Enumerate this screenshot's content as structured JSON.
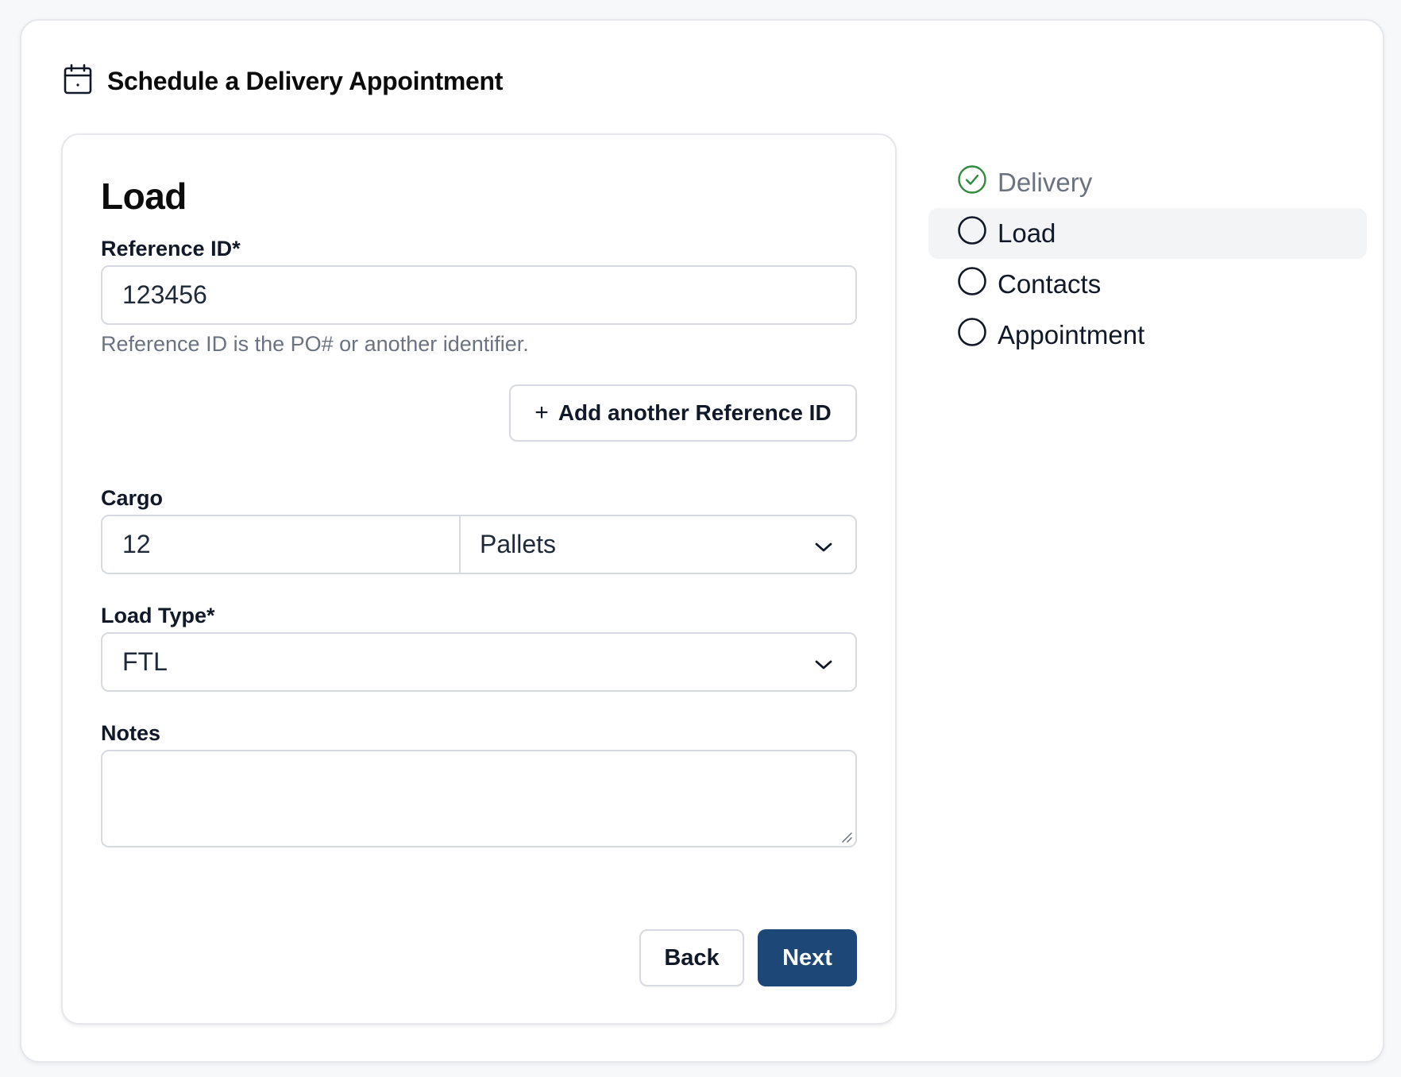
{
  "header": {
    "title": "Schedule a Delivery Appointment",
    "icon": "calendar-icon"
  },
  "form": {
    "section_title": "Load",
    "reference_id": {
      "label": "Reference ID*",
      "value": "123456",
      "help": "Reference ID is the PO# or another identifier."
    },
    "add_reference_button": {
      "plus": "+",
      "label": "Add another Reference ID"
    },
    "cargo": {
      "label": "Cargo",
      "quantity": "12",
      "unit": "Pallets"
    },
    "load_type": {
      "label": "Load Type*",
      "value": "FTL"
    },
    "notes": {
      "label": "Notes",
      "value": ""
    },
    "back_label": "Back",
    "next_label": "Next"
  },
  "steps": [
    {
      "label": "Delivery",
      "status": "complete"
    },
    {
      "label": "Load",
      "status": "current"
    },
    {
      "label": "Contacts",
      "status": "pending"
    },
    {
      "label": "Appointment",
      "status": "pending"
    }
  ],
  "colors": {
    "primary": "#1d4777",
    "success": "#2e8b3d",
    "border": "#d7dae0",
    "muted_text": "#6b7280",
    "active_step_bg": "#f3f4f6"
  }
}
